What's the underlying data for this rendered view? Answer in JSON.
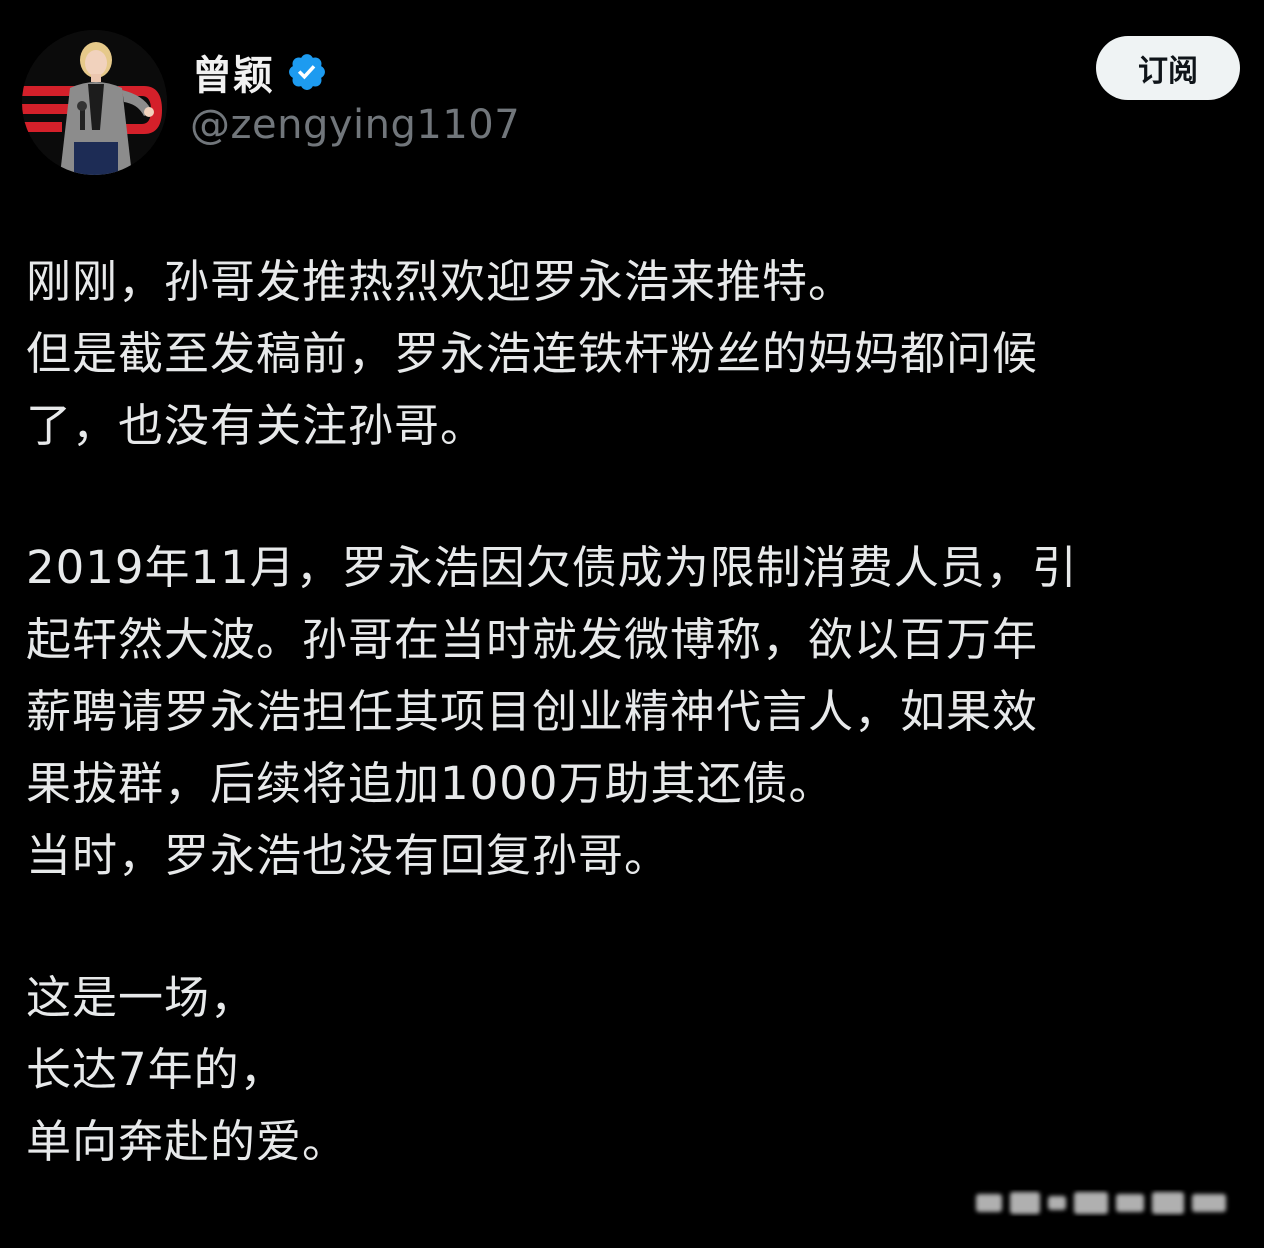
{
  "author": {
    "display_name": "曾颖",
    "handle": "@zengying1107",
    "verified": true,
    "avatar_icon": "profile-photo",
    "verified_icon": "verified-badge-icon"
  },
  "actions": {
    "subscribe_label": "订阅"
  },
  "post": {
    "paragraphs": [
      {
        "lines": [
          "刚刚，孙哥发推热烈欢迎罗永浩来推特。",
          "但是截至发稿前，罗永浩连铁杆粉丝的妈妈都问候",
          "了，也没有关注孙哥。"
        ]
      },
      {
        "lines": [
          "2019年11月，罗永浩因欠债成为限制消费人员，引",
          "起轩然大波。孙哥在当时就发微博称，欲以百万年",
          "薪聘请罗永浩担任其项目创业精神代言人，如果效",
          "果拔群，后续将追加1000万助其还债。",
          "当时，罗永浩也没有回复孙哥。"
        ]
      },
      {
        "lines": [
          "这是一场，",
          "长达7年的，",
          "单向奔赴的爱。"
        ]
      }
    ]
  },
  "colors": {
    "background": "#000000",
    "text": "#e7e9ea",
    "muted": "#71767b",
    "verified_blue": "#1d9bf0",
    "button_bg": "#eff3f4"
  }
}
